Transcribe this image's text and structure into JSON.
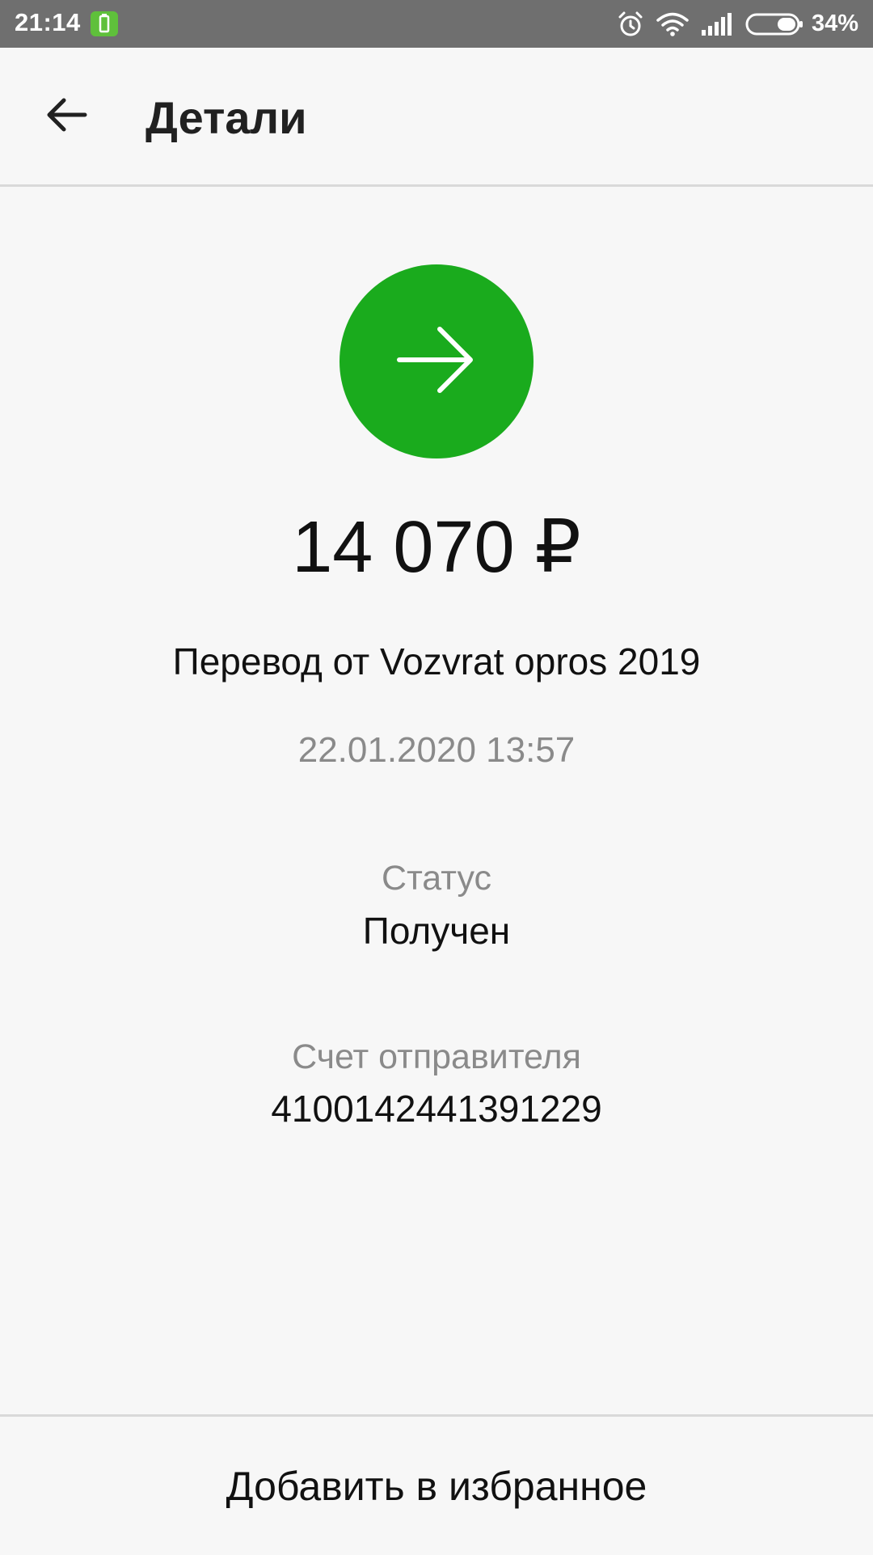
{
  "status_bar": {
    "time": "21:14",
    "battery_percent": "34%",
    "icons": [
      "charging-icon",
      "alarm-icon",
      "wifi-icon",
      "signal-icon",
      "battery-icon"
    ]
  },
  "header": {
    "back_icon": "arrow-left-icon",
    "title": "Детали"
  },
  "transaction": {
    "icon": "arrow-right-icon",
    "icon_color": "#1aab1d",
    "amount": "14 070 ₽",
    "description": "Перевод от Vozvrat opros 2019",
    "datetime": "22.01.2020 13:57",
    "status_label": "Статус",
    "status_value": "Получен",
    "sender_account_label": "Счет отправителя",
    "sender_account_value": "4100142441391229"
  },
  "footer": {
    "add_favorite_label": "Добавить в избранное"
  }
}
